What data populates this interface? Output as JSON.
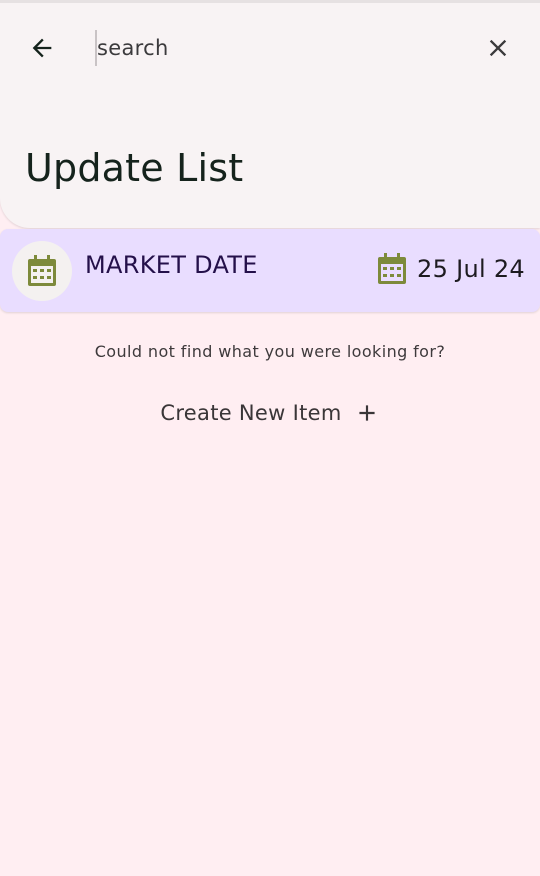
{
  "search": {
    "placeholder": "search",
    "value": ""
  },
  "header": {
    "title": "Update List"
  },
  "item": {
    "label": "MARKET DATE",
    "date": "25 Jul 24",
    "icon": "calendar-icon"
  },
  "empty_state": {
    "message": "Could not find what you were looking for?",
    "create_label": "Create New Item"
  },
  "colors": {
    "background": "#FFEEF2",
    "header_bg": "#F8F3F4",
    "item_bg": "#E9DDFF",
    "calendar_icon": "#7D8A3B",
    "title_text": "#15231C"
  }
}
